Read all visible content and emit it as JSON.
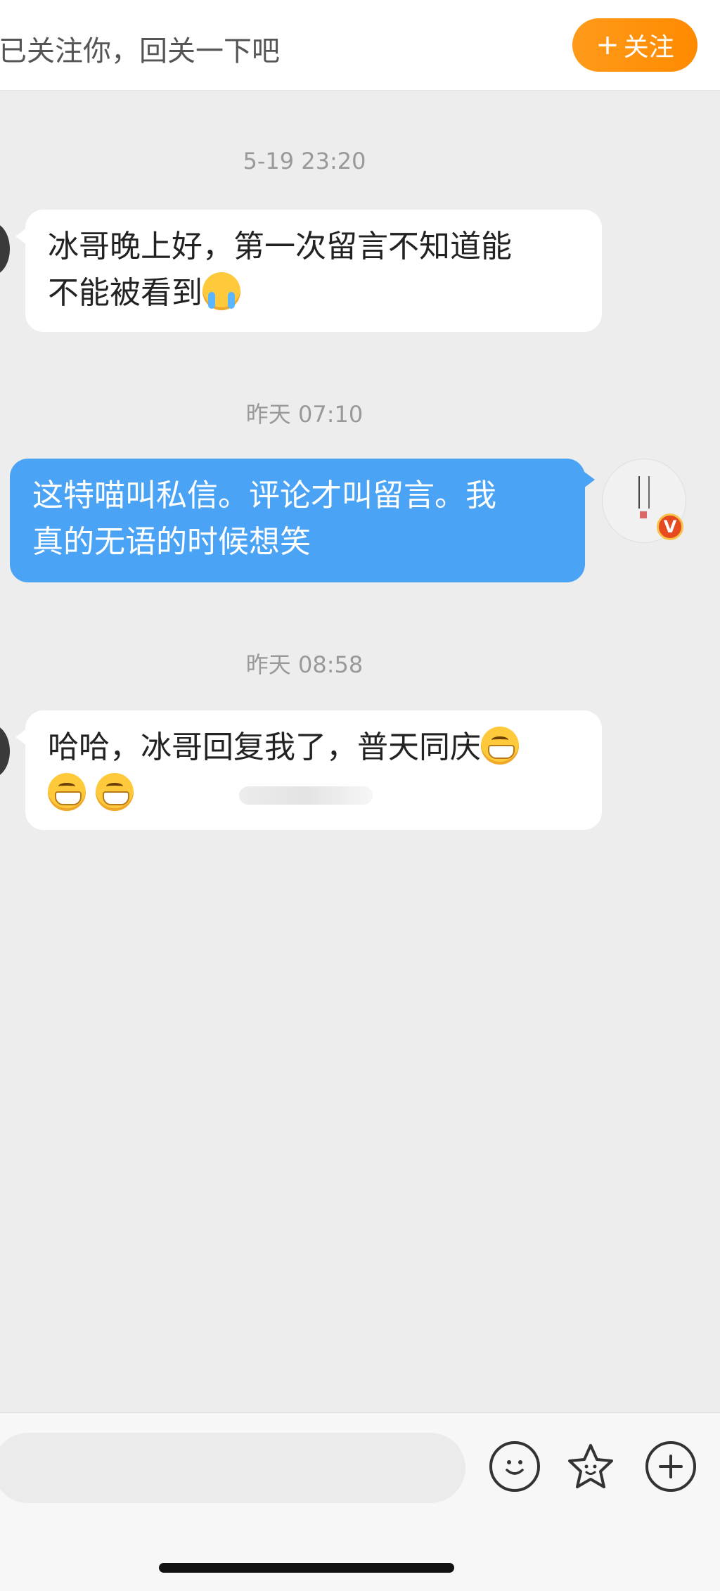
{
  "header": {
    "follow_hint": "已关注你，回关一下吧",
    "follow_button_icon": "+",
    "follow_button_label": "关注"
  },
  "messages": [
    {
      "timestamp": "5-19 23:20",
      "direction": "incoming",
      "lines": [
        "冰哥晚上好，第一次留言不知道能",
        "不能被看到"
      ],
      "emoji_after": "crying-face"
    },
    {
      "timestamp": "昨天 07:10",
      "direction": "outgoing",
      "lines": [
        "这特喵叫私信。评论才叫留言。我",
        "真的无语的时候想笑"
      ]
    },
    {
      "timestamp": "昨天 08:58",
      "direction": "incoming",
      "lines": [
        "哈哈，冰哥回复我了，普天同庆"
      ],
      "emoji_after": "grinning-face x3"
    }
  ],
  "avatar_badge": "V",
  "input": {
    "placeholder": ""
  },
  "toolbar": {
    "icons": [
      "emoji-icon",
      "sticker-icon",
      "add-icon"
    ]
  },
  "colors": {
    "follow_button": "#ff8a00",
    "outgoing_bubble": "#4aa3f5",
    "background": "#ededed"
  }
}
